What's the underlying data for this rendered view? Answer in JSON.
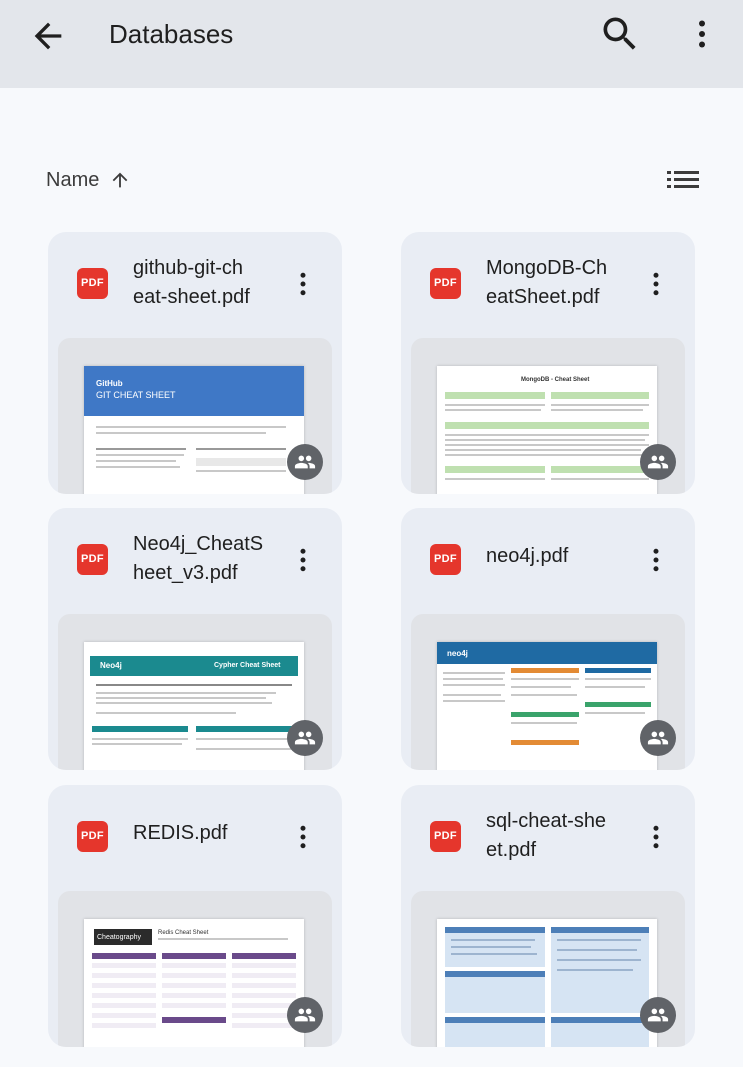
{
  "header": {
    "title": "Databases",
    "back_icon": "arrow-back-icon",
    "search_icon": "search-icon",
    "more_icon": "more-vert-icon"
  },
  "sort": {
    "label": "Name",
    "direction_icon": "arrow-upward-icon",
    "view_icon": "list-view-icon"
  },
  "files": [
    {
      "name": "github-git-ch\neat-sheet.pdf",
      "badge": "PDF",
      "thumb_title": "GitHub",
      "thumb_subtitle": "GIT CHEAT SHEET"
    },
    {
      "name": "MongoDB-Ch\neatSheet.pdf",
      "badge": "PDF",
      "thumb_title": "MongoDB - Cheat Sheet"
    },
    {
      "name": "Neo4j_CheatS\nheet_v3.pdf",
      "badge": "PDF",
      "thumb_title": "Neo4j",
      "thumb_subtitle": "Cypher Cheat Sheet"
    },
    {
      "name": "neo4j.pdf",
      "badge": "PDF",
      "thumb_title": "neo4j"
    },
    {
      "name": "REDIS.pdf",
      "badge": "PDF",
      "thumb_title": "Cheatography",
      "thumb_subtitle": "Redis Cheat Sheet"
    },
    {
      "name": "sql-cheat-she\net.pdf",
      "badge": "PDF"
    }
  ],
  "colors": {
    "appbar": "#e3e6eb",
    "card": "#e9edf4",
    "pdf_red": "#e5362c",
    "shared_badge": "#606368"
  }
}
